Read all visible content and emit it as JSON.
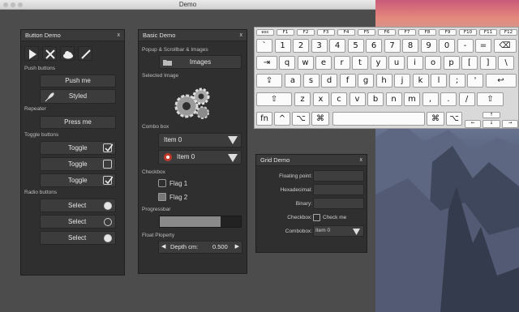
{
  "window": {
    "title": "Demo"
  },
  "button_demo": {
    "title": "Button Demo",
    "close": "x",
    "toolbar_icons": [
      "play-icon",
      "tools-icon",
      "cloud-icon",
      "pencil-icon"
    ],
    "push_label": "Push buttons",
    "push_me": "Push me",
    "styled": "Styled",
    "repeater_label": "Repeater",
    "press_me": "Press me",
    "toggle_label": "Toggle buttons",
    "toggles": [
      {
        "label": "Toggle",
        "checked": true
      },
      {
        "label": "Toggle",
        "checked": false
      },
      {
        "label": "Toggle",
        "checked": true
      }
    ],
    "radio_label": "Radio buttons",
    "radios": [
      {
        "label": "Select",
        "selected": true
      },
      {
        "label": "Select",
        "selected": false
      },
      {
        "label": "Select",
        "selected": true
      }
    ]
  },
  "basic_demo": {
    "title": "Basic Demo",
    "close": "x",
    "popup_label": "Popup & Scrollbar & Images",
    "images_button": "Images",
    "selected_image_label": "Selected Image",
    "combo_label": "Combo box",
    "combo1": "Item 0",
    "combo2": "Item 0",
    "checkbox_label": "Checkbox",
    "flag1": "Flag 1",
    "flag2": "Flag 2",
    "progress_label": "Progressbar",
    "progress_value": 0.75,
    "float_label": "Float Ploperty",
    "depth_label": "Depth cm:",
    "depth_value": "0.500"
  },
  "grid_demo": {
    "title": "Grid Demo",
    "close": "x",
    "floating": "Floating point:",
    "hex": "Hexadecimal:",
    "binary": "Binary:",
    "checkbox": "Checkbox:",
    "check_me": "Check me",
    "combobox": "Combobox:",
    "combo_value": "Item 0"
  },
  "keyboard": {
    "fn_row": [
      "esc",
      "F1",
      "F2",
      "F3",
      "F4",
      "F5",
      "F6",
      "F7",
      "F8",
      "F9",
      "F10",
      "F11",
      "F12"
    ],
    "num_row": [
      "`",
      "1",
      "2",
      "3",
      "4",
      "5",
      "6",
      "7",
      "8",
      "9",
      "0",
      "-",
      "=",
      "⌫"
    ],
    "q_row": [
      "⇥",
      "q",
      "w",
      "e",
      "r",
      "t",
      "y",
      "u",
      "i",
      "o",
      "p",
      "[",
      "]",
      "\\"
    ],
    "a_row": [
      "⇪",
      "a",
      "s",
      "d",
      "f",
      "g",
      "h",
      "j",
      "k",
      "l",
      ";",
      "'",
      "↩"
    ],
    "z_row": [
      "⇧",
      "z",
      "x",
      "c",
      "v",
      "b",
      "n",
      "m",
      ",",
      ".",
      "/",
      "⇧"
    ],
    "bottom_row": [
      "fn",
      "^",
      "⌥",
      "⌘",
      "",
      "⌘",
      "⌥"
    ],
    "arrows": [
      "↑",
      "←",
      "↓",
      "→"
    ]
  }
}
